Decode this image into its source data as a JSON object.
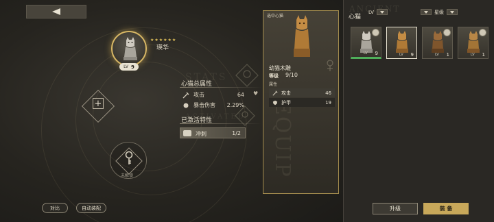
{
  "header": {
    "back_icon": "back-arrow-icon"
  },
  "cat": {
    "name": "瑛华",
    "stars": "★★★★★★",
    "lv_label": "LV",
    "level": "9"
  },
  "slots": {
    "locked_label": "未解锁"
  },
  "attributes": {
    "title": "心猫总属性",
    "rows": [
      {
        "icon": "sword-icon",
        "label": "攻击",
        "value": "64"
      },
      {
        "icon": "crit-icon",
        "label": "暴击伤害",
        "value": "2.29%"
      }
    ]
  },
  "traits": {
    "title": "已激活特性",
    "rows": [
      {
        "icon": "charge-icon",
        "label": "冲刺",
        "value": "1/2"
      }
    ]
  },
  "buttons": {
    "compare": "对比",
    "auto_equip": "自动装配",
    "upgrade": "升级",
    "equip": "装 备"
  },
  "detail": {
    "header": "选中心猫",
    "name": "幼猫木雕",
    "level_label": "等级",
    "level_value": "9/10",
    "props_label": "属性",
    "props": [
      {
        "icon": "sword-icon",
        "label": "攻击",
        "value": "46"
      },
      {
        "icon": "shield-icon",
        "label": "护甲",
        "value": "19"
      }
    ]
  },
  "list_panel": {
    "title": "心猫",
    "sort_lv": "LV",
    "sort_star": "星级",
    "cards": [
      {
        "kind": "silver",
        "lv_label": "LV",
        "level": "9",
        "badge": true,
        "selected": false,
        "green": true
      },
      {
        "kind": "wood",
        "lv_label": "LV",
        "level": "9",
        "badge": false,
        "selected": true,
        "green": false
      },
      {
        "kind": "bronze",
        "lv_label": "LV",
        "level": "1",
        "badge": true,
        "selected": false,
        "green": false
      },
      {
        "kind": "wood",
        "lv_label": "LV",
        "level": "1",
        "badge": true,
        "selected": false,
        "green": false
      }
    ]
  },
  "colors": {
    "gold": "#c8a85a",
    "green": "#4fae5a",
    "panel": "#2a2824"
  }
}
